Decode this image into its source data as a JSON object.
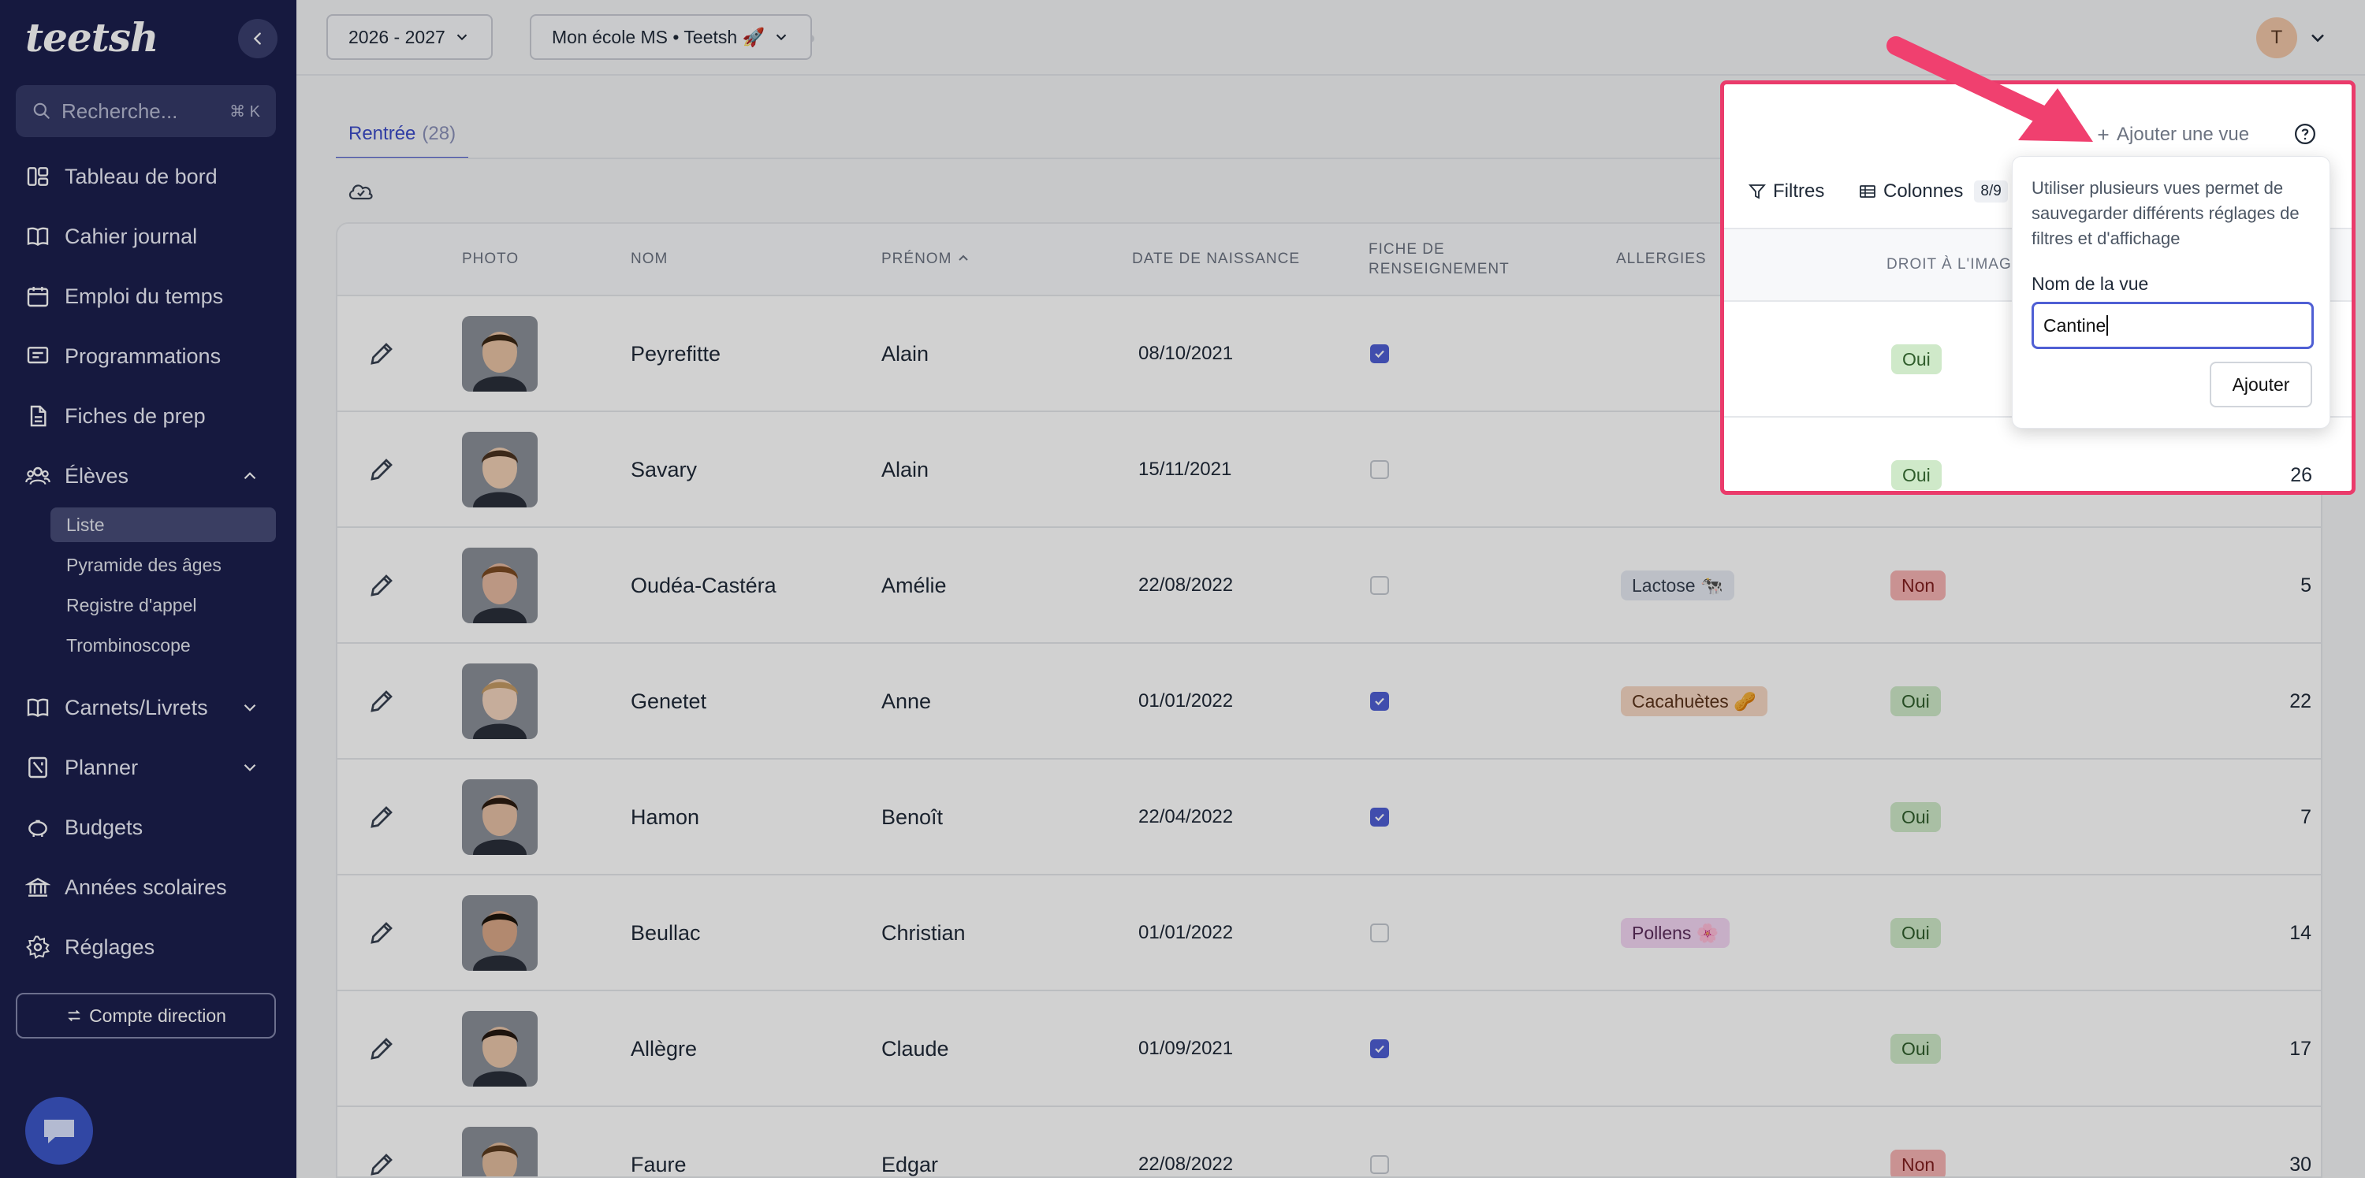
{
  "brand": {
    "logo": "teetsh",
    "accent": "#e9456e",
    "sidebar_bg": "#1b1f4d",
    "primary": "#4f5fd4"
  },
  "sidebar": {
    "search_placeholder": "Recherche...",
    "search_shortcut": "⌘ K",
    "items": [
      {
        "label": "Tableau de bord",
        "icon": "dashboard-icon"
      },
      {
        "label": "Cahier journal",
        "icon": "book-icon"
      },
      {
        "label": "Emploi du temps",
        "icon": "calendar-icon"
      },
      {
        "label": "Programmations",
        "icon": "presentation-icon"
      },
      {
        "label": "Fiches de prep",
        "icon": "file-icon"
      },
      {
        "label": "Élèves",
        "icon": "users-icon"
      },
      {
        "label": "Carnets/Livrets",
        "icon": "notebook-icon"
      },
      {
        "label": "Planner",
        "icon": "planner-icon"
      },
      {
        "label": "Budgets",
        "icon": "piggy-bank-icon"
      },
      {
        "label": "Années scolaires",
        "icon": "institution-icon"
      },
      {
        "label": "Réglages",
        "icon": "gear-icon"
      }
    ],
    "eleves_sub": [
      "Liste",
      "Pyramide des âges",
      "Registre d'appel",
      "Trombinoscope"
    ],
    "compte_button": "Compte direction"
  },
  "topbar": {
    "year": "2026 - 2027",
    "school": "Mon école MS • Teetsh 🚀",
    "avatar_initial": "T"
  },
  "tab": {
    "label": "Rentrée",
    "count": "(28)"
  },
  "table": {
    "headers": {
      "photo": "PHOTO",
      "nom": "NOM",
      "prenom": "PRÉNOM",
      "naissance": "DATE DE NAISSANCE",
      "fiche": "FICHE DE RENSEIGNEMENT",
      "allergies": "ALLERGIES",
      "droit": "DROIT À L'IMAGE"
    },
    "rows": [
      {
        "nom": "Peyrefitte",
        "prenom": "Alain",
        "date": "08/10/2021",
        "fiche": true,
        "allergie": "",
        "droit": "Oui",
        "num": ""
      },
      {
        "nom": "Savary",
        "prenom": "Alain",
        "date": "15/11/2021",
        "fiche": false,
        "allergie": "",
        "droit": "Oui",
        "num": "26"
      },
      {
        "nom": "Oudéa-Castéra",
        "prenom": "Amélie",
        "date": "22/08/2022",
        "fiche": false,
        "allergie": "Lactose 🐄",
        "droit": "Non",
        "num": "5"
      },
      {
        "nom": "Genetet",
        "prenom": "Anne",
        "date": "01/01/2022",
        "fiche": true,
        "allergie": "Cacahuètes 🥜",
        "droit": "Oui",
        "num": "22"
      },
      {
        "nom": "Hamon",
        "prenom": "Benoît",
        "date": "22/04/2022",
        "fiche": true,
        "allergie": "",
        "droit": "Oui",
        "num": "7"
      },
      {
        "nom": "Beullac",
        "prenom": "Christian",
        "date": "01/01/2022",
        "fiche": false,
        "allergie": "Pollens 🌸",
        "droit": "Oui",
        "num": "14"
      },
      {
        "nom": "Allègre",
        "prenom": "Claude",
        "date": "01/09/2021",
        "fiche": true,
        "allergie": "",
        "droit": "Oui",
        "num": "17"
      },
      {
        "nom": "Faure",
        "prenom": "Edgar",
        "date": "22/08/2022",
        "fiche": false,
        "allergie": "",
        "droit": "Non",
        "num": "30"
      }
    ]
  },
  "toolbar": {
    "add_view": "Ajouter une vue",
    "filtres": "Filtres",
    "colonnes": "Colonnes",
    "colonnes_count": "8/9",
    "droit_header_cut": "DROIT À L'IMAG"
  },
  "popover": {
    "description": "Utiliser plusieurs vues permet de sauvegarder différents réglages de filtres et d'affichage",
    "label": "Nom de la vue",
    "input_value": "Cantine",
    "button": "Ajouter"
  }
}
